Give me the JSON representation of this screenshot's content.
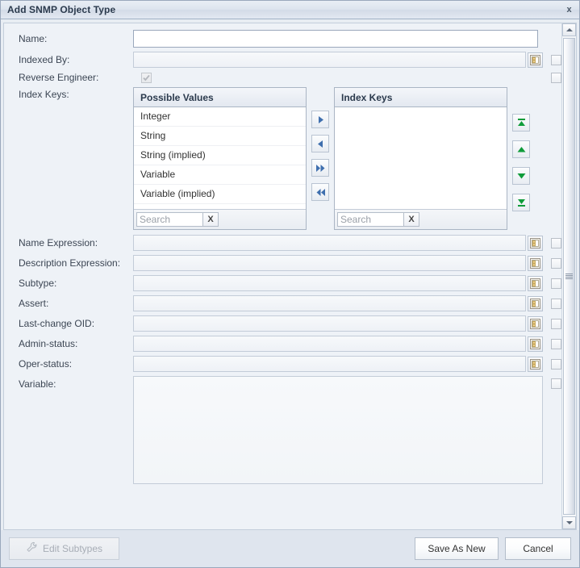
{
  "window": {
    "title": "Add SNMP Object Type",
    "close_label": "x"
  },
  "fields": {
    "name": {
      "label": "Name:",
      "value": "",
      "placeholder": ""
    },
    "indexed_by": {
      "label": "Indexed By:",
      "value": "",
      "placeholder": ""
    },
    "reverse_engineer": {
      "label": "Reverse Engineer:",
      "checked": true
    },
    "index_keys": {
      "label": "Index Keys:"
    },
    "name_expression": {
      "label": "Name Expression:",
      "value": "",
      "placeholder": ""
    },
    "description_expression": {
      "label": "Description Expression:",
      "value": "",
      "placeholder": ""
    },
    "subtype": {
      "label": "Subtype:",
      "value": "",
      "placeholder": ""
    },
    "assert": {
      "label": "Assert:",
      "value": "",
      "placeholder": ""
    },
    "last_change_oid": {
      "label": "Last-change OID:",
      "value": "",
      "placeholder": ""
    },
    "admin_status": {
      "label": "Admin-status:",
      "value": "",
      "placeholder": ""
    },
    "oper_status": {
      "label": "Oper-status:",
      "value": "",
      "placeholder": ""
    },
    "variable": {
      "label": "Variable:",
      "value": "",
      "placeholder": ""
    }
  },
  "possible_values": {
    "header": "Possible Values",
    "items": [
      "Integer",
      "String",
      "String (implied)",
      "Variable",
      "Variable (implied)"
    ],
    "search": {
      "value": "",
      "placeholder": "Search",
      "clear_label": "X"
    }
  },
  "index_keys_list": {
    "header": "Index Keys",
    "items": [],
    "search": {
      "value": "",
      "placeholder": "Search",
      "clear_label": "X"
    }
  },
  "transfer_buttons": [
    {
      "name": "move-right-icon",
      "title": "Add"
    },
    {
      "name": "move-left-icon",
      "title": "Remove"
    },
    {
      "name": "move-all-right-icon",
      "title": "Add All"
    },
    {
      "name": "move-all-left-icon",
      "title": "Remove All"
    }
  ],
  "order_buttons": [
    {
      "name": "move-to-top-icon",
      "title": "Move To Top"
    },
    {
      "name": "move-up-icon",
      "title": "Move Up"
    },
    {
      "name": "move-down-icon",
      "title": "Move Down"
    },
    {
      "name": "move-to-bottom-icon",
      "title": "Move To Bottom"
    }
  ],
  "footer": {
    "edit_subtypes": "Edit Subtypes",
    "save_as_new": "Save As New",
    "cancel": "Cancel"
  },
  "colors": {
    "dialog_bg": "#e8edf3",
    "content_bg": "#eef2f7",
    "footer_bg": "#dfe5ee",
    "border": "#c3cedb",
    "title_text": "#2b3a4d",
    "blue_arrow": "#3f6fae",
    "green_arrow": "#0f9c3a"
  }
}
